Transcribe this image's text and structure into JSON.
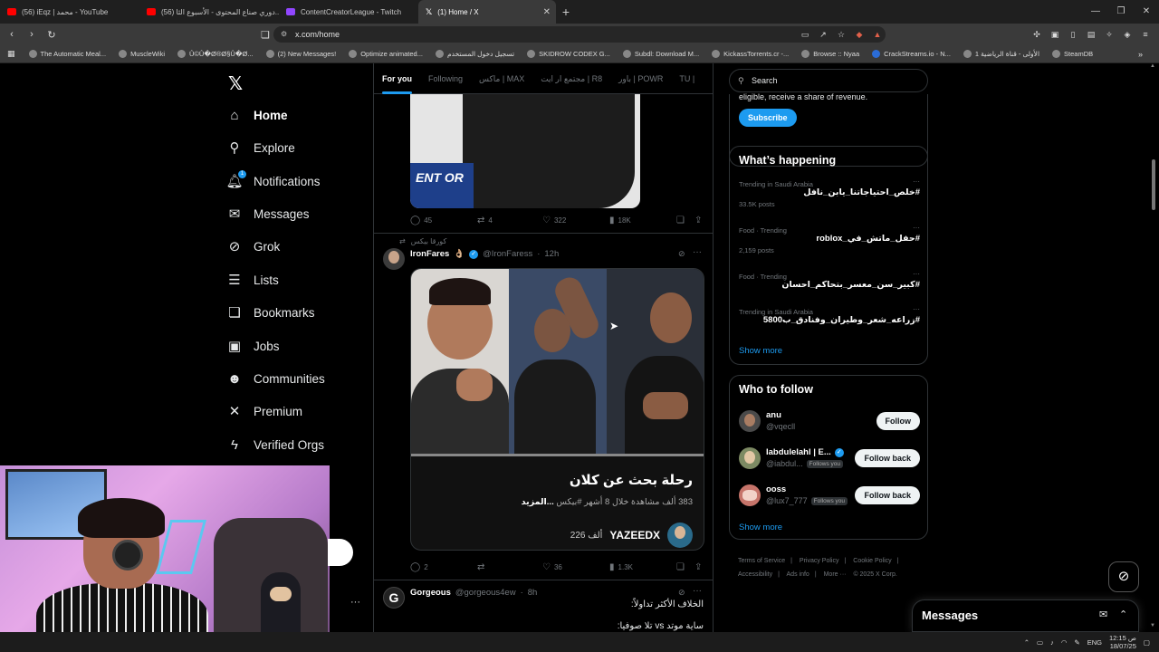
{
  "browser": {
    "tabs": [
      {
        "title": "(56) iEqz | محمد - YouTube",
        "favicon_color": "#ff0000"
      },
      {
        "title": "(56) دوري صناع المحتوى - الأسبوع الثا...",
        "favicon_color": "#ff0000"
      },
      {
        "title": "ContentCreatorLeague - Twitch",
        "favicon_color": "#9146ff"
      },
      {
        "title": "(1) Home / X",
        "favicon_color": "#ffffff"
      }
    ],
    "new_tab": "+",
    "url": "x.com/home",
    "bookmarks": [
      "The Automatic Meal...",
      "MuscleWiki",
      "Û©Û�Ø®Ø§Û�Ø...",
      "(2) New Messages!",
      "Optimize animated...",
      "تسجيل دخول المستخدم",
      "SKIDROW CODEX G...",
      "Subdl: Download M...",
      "KickassTorrents.cr -...",
      "Browse :: Nyaa",
      "CrackStreams.io - N...",
      "الأولى - قناة الرياضية 1",
      "SteamDB"
    ]
  },
  "nav": {
    "items": [
      {
        "label": "Home",
        "icon": "home-icon",
        "glyph": "⌂",
        "active": true
      },
      {
        "label": "Explore",
        "icon": "search-icon",
        "glyph": "⚲"
      },
      {
        "label": "Notifications",
        "icon": "bell-icon",
        "glyph": "♫",
        "badge": "1"
      },
      {
        "label": "Messages",
        "icon": "envelope-icon",
        "glyph": "✉"
      },
      {
        "label": "Grok",
        "icon": "grok-icon",
        "glyph": "⊘"
      },
      {
        "label": "Lists",
        "icon": "list-icon",
        "glyph": "☰"
      },
      {
        "label": "Bookmarks",
        "icon": "bookmark-icon",
        "glyph": "❏"
      },
      {
        "label": "Jobs",
        "icon": "briefcase-icon",
        "glyph": "▣"
      },
      {
        "label": "Communities",
        "icon": "people-icon",
        "glyph": "☻"
      },
      {
        "label": "Premium",
        "icon": "x-premium-icon",
        "glyph": "✕"
      },
      {
        "label": "Verified Orgs",
        "icon": "lightning-icon",
        "glyph": "ϟ"
      }
    ]
  },
  "feed": {
    "tabs": [
      {
        "label": "For you",
        "active": true
      },
      {
        "label": "Following"
      },
      {
        "label": "ماكس | MAX"
      },
      {
        "label": "مجتمع ار ايت | R8"
      },
      {
        "label": "باور | POWR"
      },
      {
        "label": "TU |"
      }
    ],
    "post1": {
      "replies": "45",
      "reposts": "4",
      "likes": "322",
      "views": "18K",
      "image_text": "ENT OR"
    },
    "post2": {
      "reposted_by": "كورقا بيكس",
      "name": "IronFares",
      "name_emoji": "👌🏼",
      "handle": "@IronFaress",
      "time": "12h",
      "card_title": "رحلة بحث عن كلان",
      "card_views": "383 ألف مشاهدة",
      "card_age": "خلال 8 أشهر",
      "card_tag": "#بيكس",
      "card_more": "...المزيد",
      "card_author": "YAZEEDX",
      "card_followers": "226 ألف",
      "replies": "2",
      "reposts": "",
      "likes": "36",
      "views": "1.3K"
    },
    "post3": {
      "avatar_letter": "G",
      "name": "Gorgeous",
      "handle": "@gorgeous4ew",
      "time": "8h",
      "text1": "الخلاف الأكثر تداولاً:",
      "text2": "ساية موتد vs تلا صوفيا:"
    }
  },
  "sidebar": {
    "search_placeholder": "Search",
    "premium_text": "eligible, receive a share of revenue.",
    "subscribe": "Subscribe",
    "whats_happening": "What’s happening",
    "trends": [
      {
        "context": "Trending in Saudi Arabia",
        "name": "#خلص_احتياجاتنا_يابن_نافل",
        "posts": "33.5K posts"
      },
      {
        "context": "Food · Trending",
        "name": "#حفل_ماتش_في_roblox",
        "posts": "2,159 posts"
      },
      {
        "context": "Food · Trending",
        "name": "#كبير_سن_معسر_بتحاكم_احسان",
        "posts": ""
      },
      {
        "context": "Trending in Saudi Arabia",
        "name": "#زراعه_شعر_وطيران_وفنادق_ب5800",
        "posts": ""
      }
    ],
    "show_more": "Show more",
    "who_to_follow": "Who to follow",
    "follow": [
      {
        "name": "anu",
        "handle": "@vqecll",
        "follows_you": "",
        "button": "Follow",
        "verified": false
      },
      {
        "name": "Iabdulelahl | E...",
        "handle": "@iabdul...",
        "follows_you": "Follows you",
        "button": "Follow back",
        "verified": true
      },
      {
        "name": "ooss",
        "handle": "@lux7_777",
        "follows_you": "Follows you",
        "button": "Follow back",
        "verified": false
      }
    ],
    "show_more_2": "Show more",
    "footer": [
      "Terms of Service",
      "|",
      "Privacy Policy",
      "|",
      "Cookie Policy",
      "|",
      "Accessibility",
      "|",
      "Ads info",
      "|",
      "More ···",
      "© 2025 X Corp."
    ]
  },
  "messages_dock": {
    "title": "Messages"
  },
  "taskbar": {
    "lang": "ENG",
    "time": "12:15 ص",
    "date": "18/07/25"
  },
  "colors": {
    "accent": "#1d9bf0",
    "bg": "#000000",
    "border": "#2f3336",
    "muted": "#71767b"
  }
}
